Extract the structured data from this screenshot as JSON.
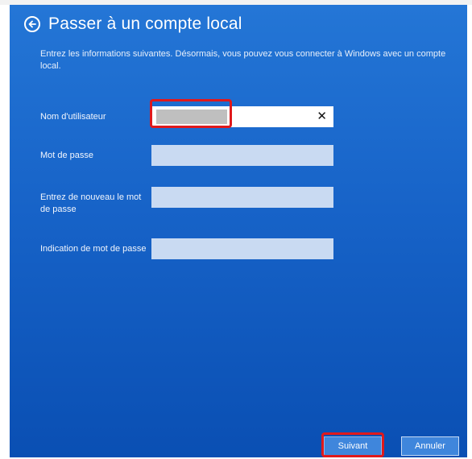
{
  "header": {
    "title": "Passer à un compte local",
    "back_icon": "arrow-left-circle-icon"
  },
  "description": "Entrez les informations suivantes. Désormais, vous pouvez vous connecter à Windows avec un compte local.",
  "form": {
    "username_label": "Nom d'utilisateur",
    "username_value": "",
    "password_label": "Mot de passe",
    "password_confirm_label": "Entrez de nouveau le mot de passe",
    "password_hint_label": "Indication de mot de passe"
  },
  "buttons": {
    "next_label": "Suivant",
    "cancel_label": "Annuler"
  },
  "colors": {
    "panel_blue": "#1763c8",
    "field_bg": "#c9daf2",
    "highlight_red": "#e0191c"
  }
}
